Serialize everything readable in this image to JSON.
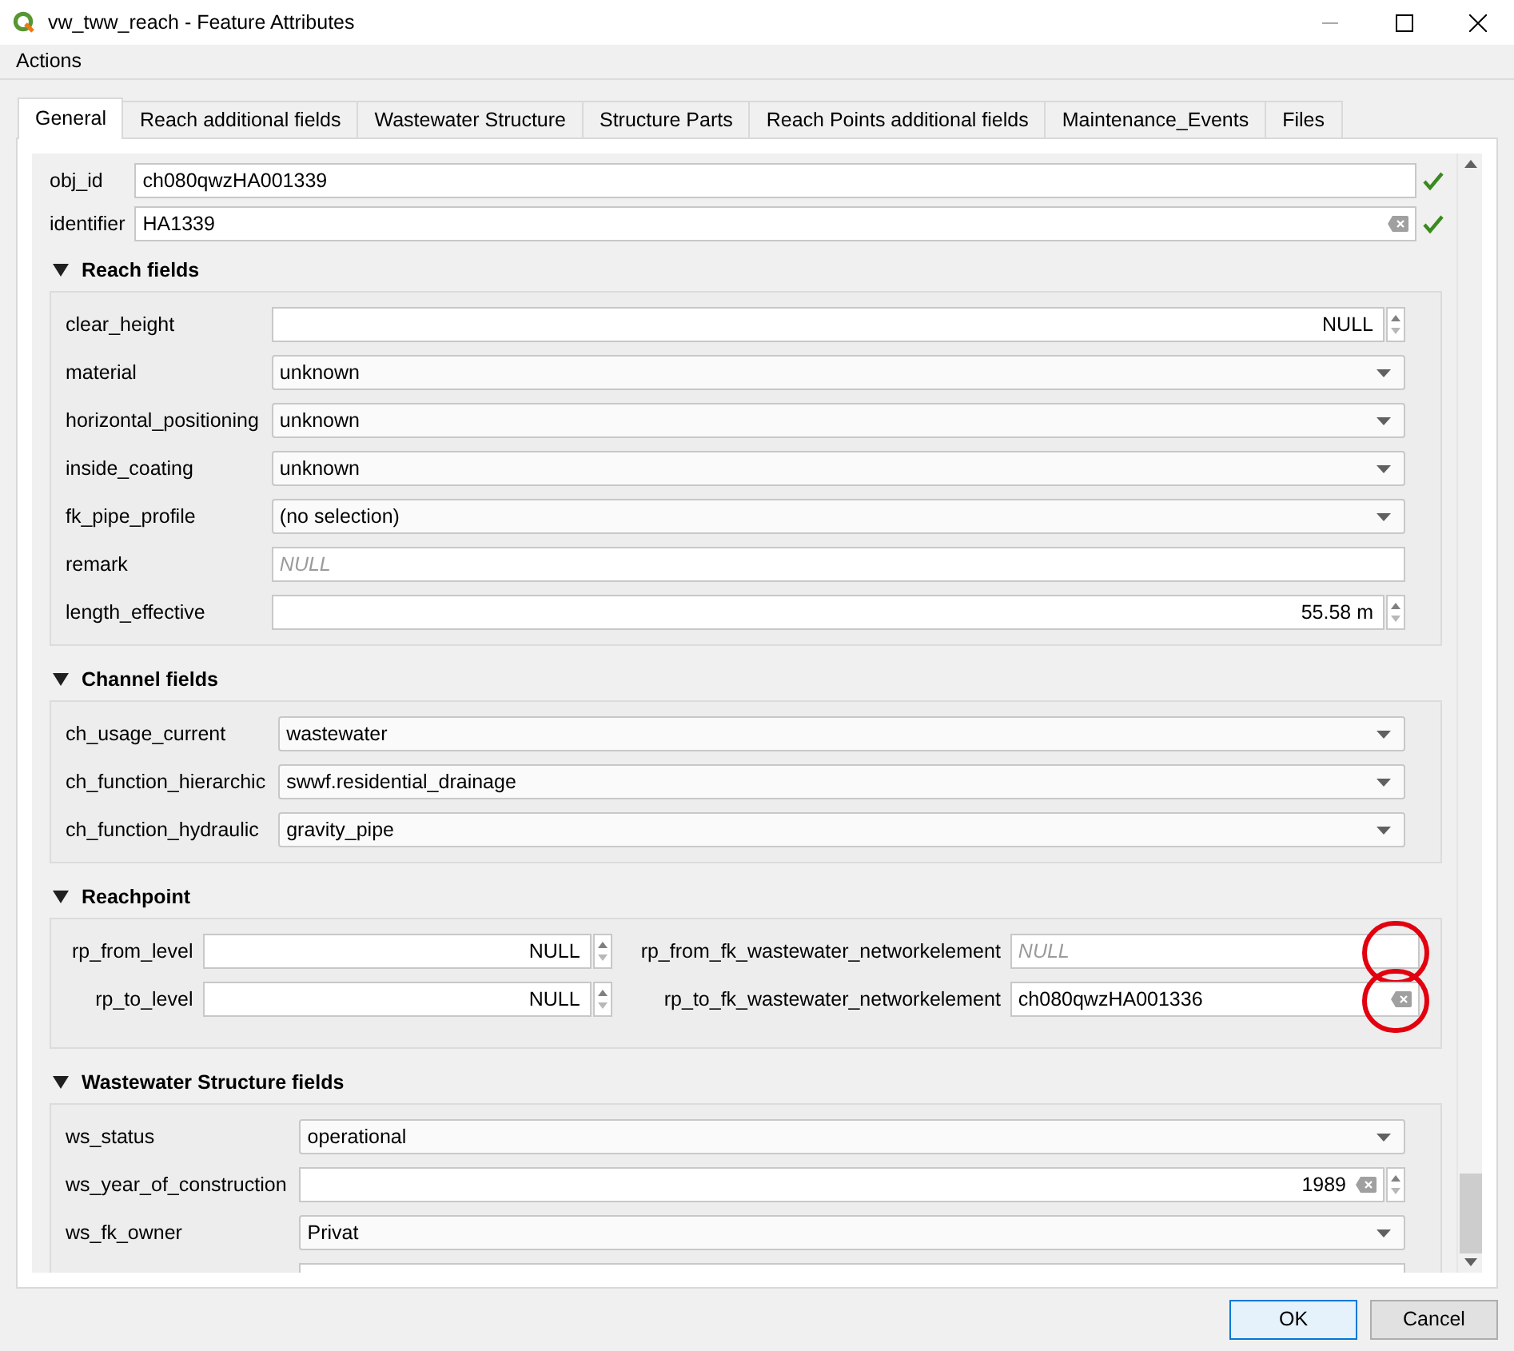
{
  "window": {
    "title": "vw_tww_reach - Feature Attributes"
  },
  "menu": [
    "Actions"
  ],
  "tabs": [
    {
      "label": "General",
      "selected": true
    },
    {
      "label": "Reach additional fields",
      "selected": false
    },
    {
      "label": "Wastewater Structure",
      "selected": false
    },
    {
      "label": "Structure Parts",
      "selected": false
    },
    {
      "label": "Reach Points additional fields",
      "selected": false
    },
    {
      "label": "Maintenance_Events",
      "selected": false
    },
    {
      "label": "Files",
      "selected": false
    }
  ],
  "top_fields": [
    {
      "label": "obj_id",
      "value": "ch080qwzHA001339",
      "clearable": false,
      "valid": true
    },
    {
      "label": "identifier",
      "value": "HA1339",
      "clearable": true,
      "valid": true
    }
  ],
  "sections": [
    {
      "title": "Reach fields",
      "expanded": true,
      "fields": [
        {
          "label": "clear_height",
          "kind": "spin",
          "value": "NULL"
        },
        {
          "label": "material",
          "kind": "combo",
          "value": "unknown"
        },
        {
          "label": "horizontal_positioning",
          "kind": "combo",
          "value": "unknown"
        },
        {
          "label": "inside_coating",
          "kind": "combo",
          "value": "unknown"
        },
        {
          "label": "fk_pipe_profile",
          "kind": "combo",
          "value": "(no selection)"
        },
        {
          "label": "remark",
          "kind": "text",
          "placeholder": "NULL"
        },
        {
          "label": "length_effective",
          "kind": "spin",
          "value": "55.58 m"
        }
      ]
    },
    {
      "title": "Channel fields",
      "expanded": true,
      "fields": [
        {
          "label": "ch_usage_current",
          "kind": "combo",
          "value": "wastewater"
        },
        {
          "label": "ch_function_hierarchic",
          "kind": "combo",
          "value": "swwf.residential_drainage"
        },
        {
          "label": "ch_function_hydraulic",
          "kind": "combo",
          "value": "gravity_pipe"
        }
      ]
    },
    {
      "title": "Reachpoint",
      "expanded": true,
      "rows": [
        {
          "left": {
            "label": "rp_from_level",
            "kind": "spin",
            "value": "NULL"
          },
          "right": {
            "label": "rp_from_fk_wastewater_networkelement",
            "kind": "text",
            "placeholder": "NULL",
            "highlighted": true
          }
        },
        {
          "left": {
            "label": "rp_to_level",
            "kind": "spin",
            "value": "NULL"
          },
          "right": {
            "label": "rp_to_fk_wastewater_networkelement",
            "kind": "text",
            "value": "ch080qwzHA001336",
            "clearable": true,
            "highlighted": true
          }
        }
      ]
    },
    {
      "title": "Wastewater Structure fields",
      "expanded": true,
      "fields": [
        {
          "label": "ws_status",
          "kind": "combo",
          "value": "operational"
        },
        {
          "label": "ws_year_of_construction",
          "kind": "spin",
          "value": "1989",
          "clearable": true
        },
        {
          "label": "ws_fk_owner",
          "kind": "combo",
          "value": "Privat"
        },
        {
          "kind": "cut"
        }
      ]
    }
  ],
  "buttons": [
    {
      "label": "OK",
      "default": true
    },
    {
      "label": "Cancel",
      "default": false
    }
  ]
}
